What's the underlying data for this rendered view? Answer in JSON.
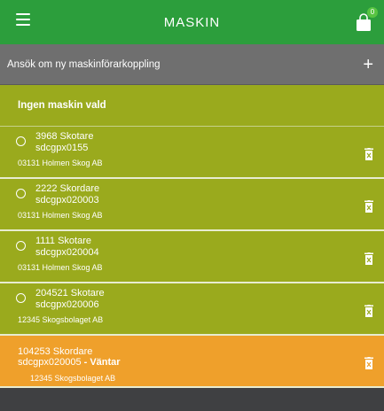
{
  "header": {
    "title": "MASKIN",
    "badge_count": "0"
  },
  "apply_row": {
    "label": "Ansök om ny maskinförarkoppling"
  },
  "selected_row": {
    "label": "Ingen maskin vald"
  },
  "machines": [
    {
      "name": "3968 Skotare",
      "code": "sdcgpx0155",
      "org": "03131 Holmen Skog AB"
    },
    {
      "name": "2222 Skordare",
      "code": "sdcgpx020003",
      "org": "03131 Holmen Skog AB"
    },
    {
      "name": "1111 Skotare",
      "code": "sdcgpx020004",
      "org": "03131 Holmen Skog AB"
    },
    {
      "name": "204521 Skotare",
      "code": "sdcgpx020006",
      "org": "12345 Skogsbolaget AB"
    }
  ],
  "pending_machine": {
    "name": "104253 Skordare",
    "code": "sdcgpx020005",
    "status": " - Väntar",
    "org": "12345 Skogsbolaget AB"
  },
  "colors": {
    "header": "#2c9e3c",
    "apply_row": "#6f6f6f",
    "machine_row": "#9aaa1d",
    "pending_row": "#efa02b",
    "background": "#3f4042"
  }
}
